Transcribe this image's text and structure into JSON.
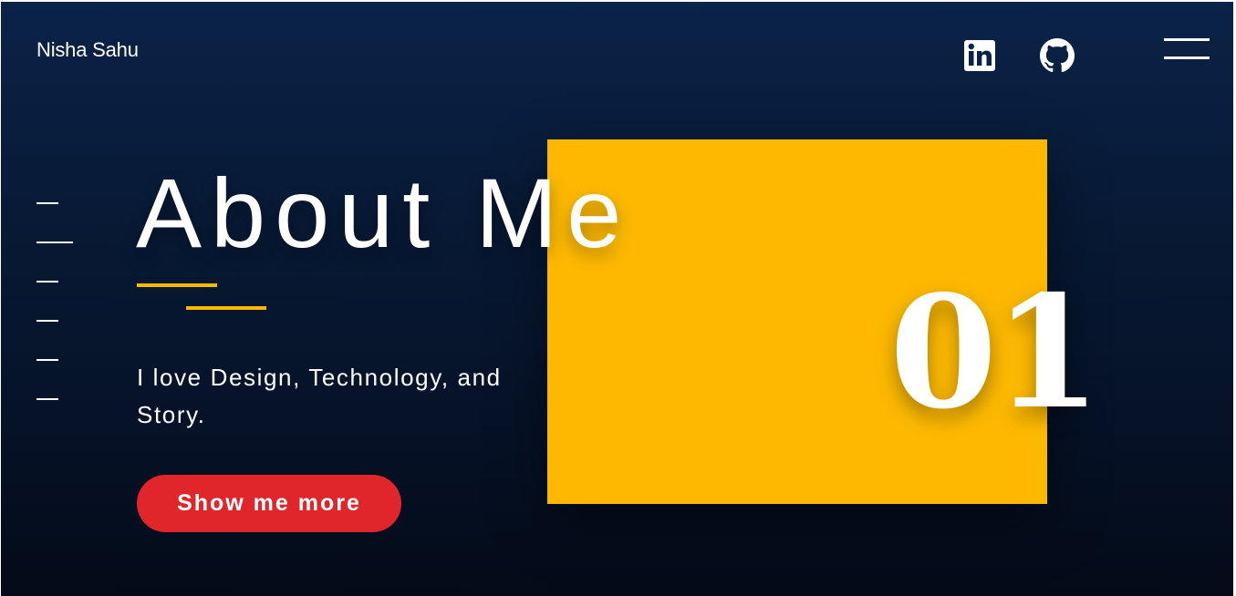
{
  "header": {
    "brand": "Nisha Sahu",
    "social": [
      {
        "icon": "linkedin-icon"
      },
      {
        "icon": "github-icon"
      }
    ],
    "menu_icon": "hamburger-menu-icon"
  },
  "side_nav": {
    "items": 6,
    "active_index": 1
  },
  "hero": {
    "title": "About Me",
    "tagline": "I love Design, Technology, and Story.",
    "cta_label": "Show me more",
    "section_number": "01"
  },
  "colors": {
    "background_top": "#0a2348",
    "background_bottom": "#040b18",
    "accent_yellow": "#fdb900",
    "cta_red": "#e0262a",
    "text": "#ffffff"
  }
}
